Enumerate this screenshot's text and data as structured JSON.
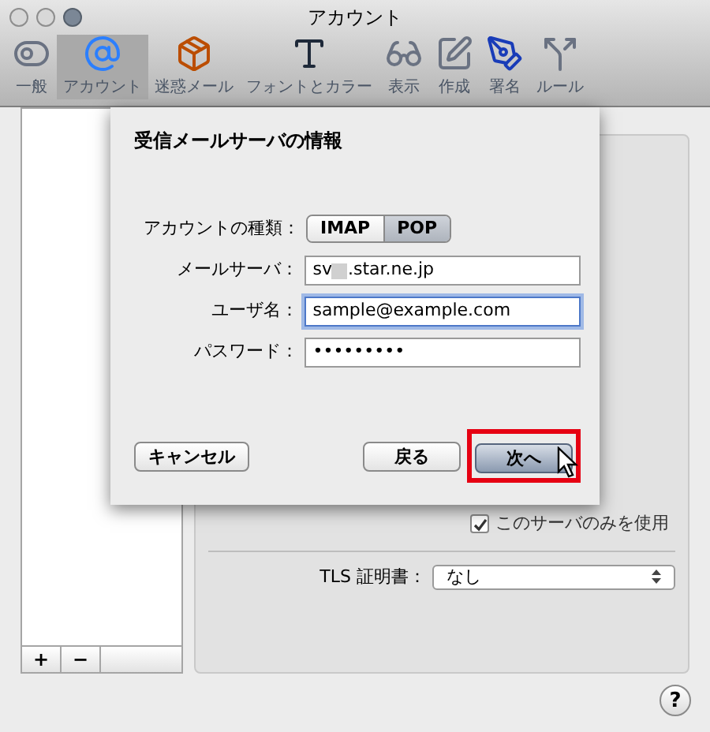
{
  "window": {
    "title": "アカウント"
  },
  "toolbar": [
    {
      "label": "一般",
      "selected": false
    },
    {
      "label": "アカウント",
      "selected": true
    },
    {
      "label": "迷惑メール",
      "selected": false
    },
    {
      "label": "フォントとカラー",
      "selected": false
    },
    {
      "label": "表示",
      "selected": false
    },
    {
      "label": "作成",
      "selected": false
    },
    {
      "label": "署名",
      "selected": false
    },
    {
      "label": "ルール",
      "selected": false
    }
  ],
  "account_list": {
    "buttons": [
      "+",
      "−"
    ]
  },
  "panel": {
    "use_only_server": {
      "label": "このサーバのみを使用",
      "checked": true
    },
    "tls": {
      "label": "TLS 証明書：",
      "value": "なし"
    }
  },
  "sheet": {
    "title": "受信メールサーバの情報",
    "account_type": {
      "label": "アカウントの種類：",
      "options": [
        {
          "label": "IMAP",
          "selected": false
        },
        {
          "label": "POP",
          "selected": true
        }
      ]
    },
    "fields": [
      {
        "label": "メールサーバ：",
        "value": "sv",
        "value_after_redaction": ".star.ne.jp",
        "focused": false
      },
      {
        "label": "ユーザ名：",
        "value": "sample@example.com",
        "focused": true
      },
      {
        "label": "パスワード：",
        "value": "•••••••••",
        "focused": false
      }
    ],
    "buttons": [
      {
        "label": "キャンセル",
        "kind": "cancel",
        "highlighted": false
      },
      {
        "label": "戻る",
        "kind": "back",
        "highlighted": false
      },
      {
        "label": "次へ",
        "kind": "default",
        "highlighted": true
      }
    ]
  },
  "help": "?"
}
